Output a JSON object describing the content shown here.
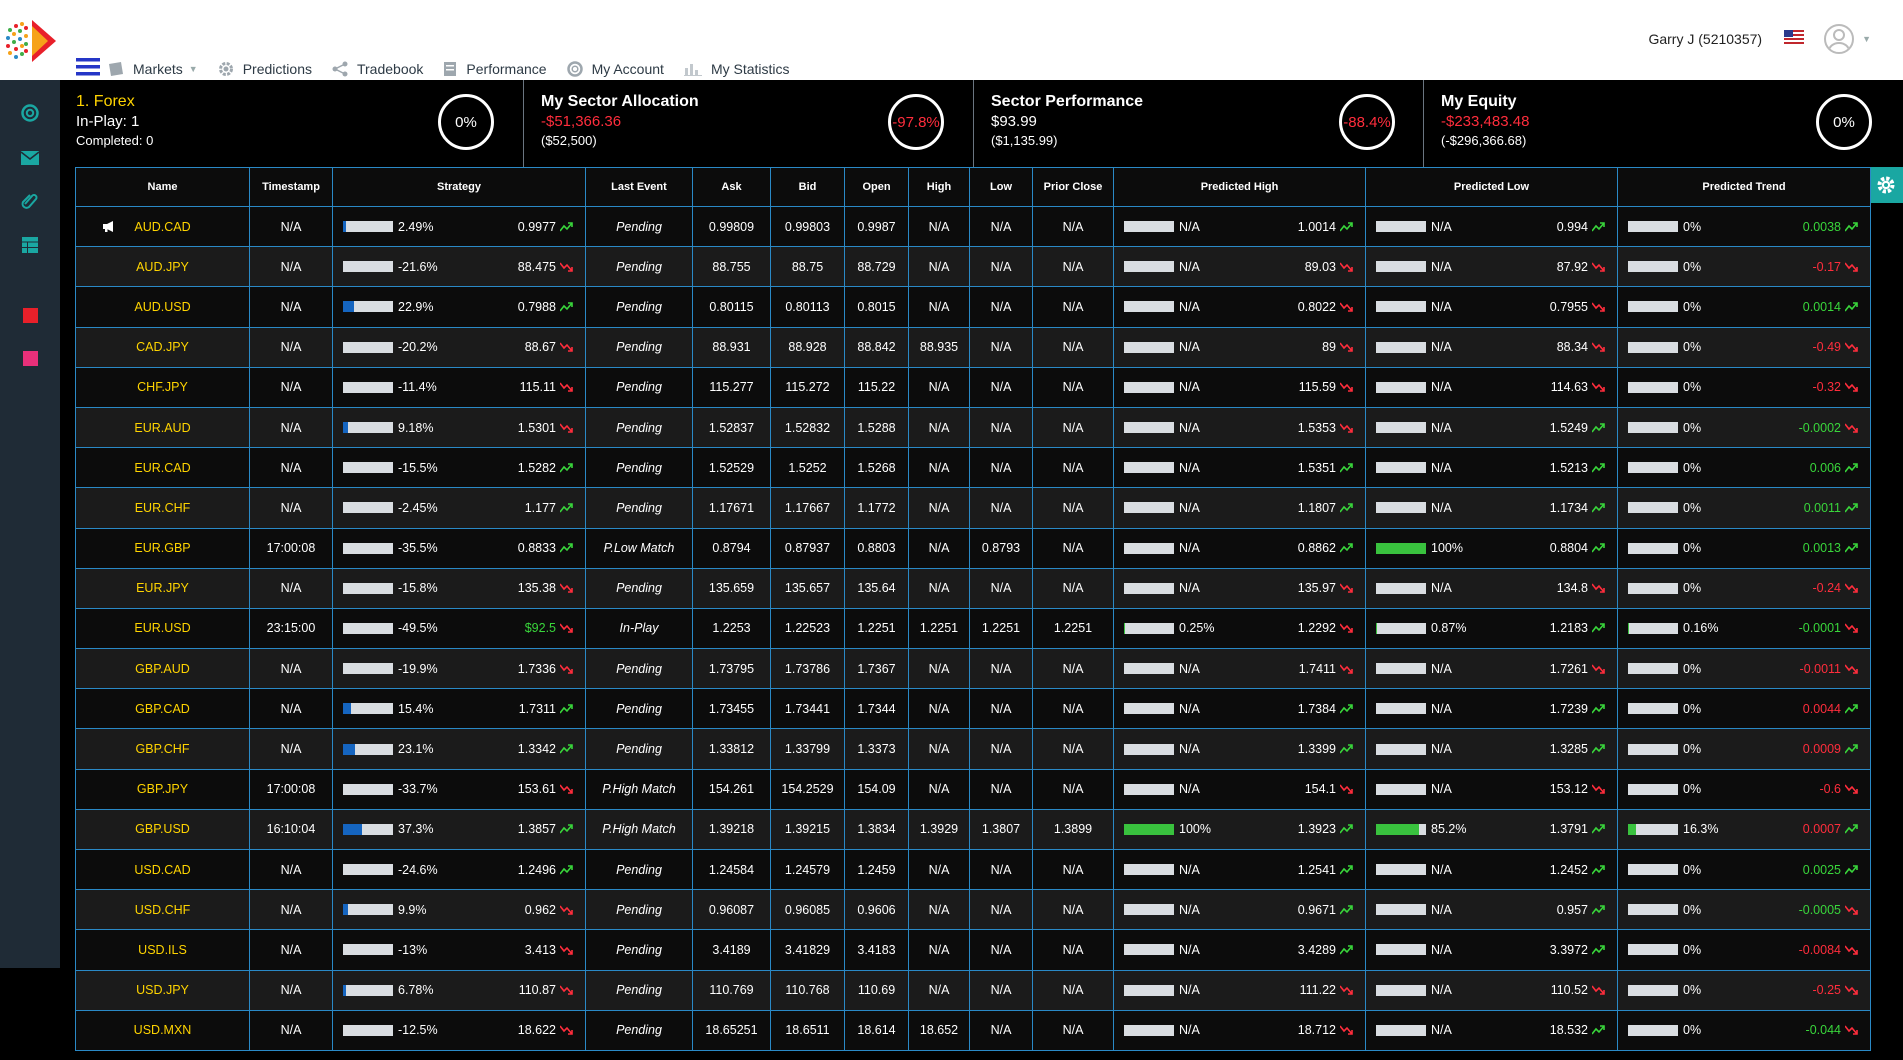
{
  "header": {
    "nav": [
      {
        "label": "Markets",
        "icon": "markets-icon",
        "has_caret": true
      },
      {
        "label": "Predictions",
        "icon": "gear-icon"
      },
      {
        "label": "Tradebook",
        "icon": "share-icon"
      },
      {
        "label": "Performance",
        "icon": "document-icon"
      },
      {
        "label": "My Account",
        "icon": "lifebuoy-icon"
      },
      {
        "label": "My Statistics",
        "icon": "bar-chart-icon"
      }
    ],
    "user": {
      "name": "Garry J (5210357)",
      "flag": "us-flag-icon"
    }
  },
  "sidebar": {
    "icons": [
      "lifebuoy-icon",
      "mail-icon",
      "paperclip-icon",
      "table-icon",
      "red-square-icon",
      "pink-square-icon"
    ]
  },
  "summary": {
    "forex": {
      "title": "1. Forex",
      "line2": "In-Play: 1",
      "line3": "Completed: 0",
      "ring": "0%"
    },
    "allocation": {
      "title": "My Sector Allocation",
      "line2": "-$51,366.36",
      "line3": "($52,500)",
      "ring": "-97.8%"
    },
    "performance": {
      "title": "Sector Performance",
      "line2": "$93.99",
      "line3": "($1,135.99)",
      "ring": "-88.4%"
    },
    "equity": {
      "title": "My Equity",
      "line2": "-$233,483.48",
      "line3": "(-$296,366.68)",
      "ring": "0%"
    }
  },
  "colors": {
    "up": "#39d63b",
    "down": "#ff2d3c",
    "accent": "#2a89c6",
    "name": "#ffd400",
    "strategy_fill": "#1565c0",
    "pred_fill": "#39c23e"
  },
  "table": {
    "headers": [
      "Name",
      "Timestamp",
      "Strategy",
      "Last Event",
      "Ask",
      "Bid",
      "Open",
      "High",
      "Low",
      "Prior Close",
      "Predicted High",
      "Predicted Low",
      "Predicted Trend"
    ],
    "rows": [
      {
        "name": "AUD.CAD",
        "ts": "N/A",
        "s_pct": "2.49%",
        "s_fill": 0.05,
        "s_val": "0.9977",
        "s_dir": "up",
        "s_col": "",
        "event": "Pending",
        "ask": "0.99809",
        "bid": "0.99803",
        "open": "0.9987",
        "high": "N/A",
        "low": "N/A",
        "prior": "N/A",
        "ph_pct": "N/A",
        "ph_fill": 0,
        "ph_val": "1.0014",
        "ph_dir": "up",
        "pl_pct": "N/A",
        "pl_fill": 0,
        "pl_val": "0.994",
        "pl_dir": "up",
        "pt_pct": "0%",
        "pt_fill": 0,
        "pt_val": "0.0038",
        "pt_dir": "up",
        "pt_col": "up",
        "megaphone": true
      },
      {
        "name": "AUD.JPY",
        "ts": "N/A",
        "s_pct": "-21.6%",
        "s_fill": 0,
        "s_val": "88.475",
        "s_dir": "down",
        "s_col": "",
        "event": "Pending",
        "ask": "88.755",
        "bid": "88.75",
        "open": "88.729",
        "high": "N/A",
        "low": "N/A",
        "prior": "N/A",
        "ph_pct": "N/A",
        "ph_fill": 0,
        "ph_val": "89.03",
        "ph_dir": "down",
        "pl_pct": "N/A",
        "pl_fill": 0,
        "pl_val": "87.92",
        "pl_dir": "down",
        "pt_pct": "0%",
        "pt_fill": 0,
        "pt_val": "-0.17",
        "pt_dir": "down",
        "pt_col": "down"
      },
      {
        "name": "AUD.USD",
        "ts": "N/A",
        "s_pct": "22.9%",
        "s_fill": 0.229,
        "s_val": "0.7988",
        "s_dir": "up",
        "s_col": "",
        "event": "Pending",
        "ask": "0.80115",
        "bid": "0.80113",
        "open": "0.8015",
        "high": "N/A",
        "low": "N/A",
        "prior": "N/A",
        "ph_pct": "N/A",
        "ph_fill": 0,
        "ph_val": "0.8022",
        "ph_dir": "down",
        "pl_pct": "N/A",
        "pl_fill": 0,
        "pl_val": "0.7955",
        "pl_dir": "down",
        "pt_pct": "0%",
        "pt_fill": 0,
        "pt_val": "0.0014",
        "pt_dir": "up",
        "pt_col": "up"
      },
      {
        "name": "CAD.JPY",
        "ts": "N/A",
        "s_pct": "-20.2%",
        "s_fill": 0,
        "s_val": "88.67",
        "s_dir": "down",
        "s_col": "",
        "event": "Pending",
        "ask": "88.931",
        "bid": "88.928",
        "open": "88.842",
        "high": "88.935",
        "low": "N/A",
        "prior": "N/A",
        "ph_pct": "N/A",
        "ph_fill": 0,
        "ph_val": "89",
        "ph_dir": "down",
        "pl_pct": "N/A",
        "pl_fill": 0,
        "pl_val": "88.34",
        "pl_dir": "down",
        "pt_pct": "0%",
        "pt_fill": 0,
        "pt_val": "-0.49",
        "pt_dir": "down",
        "pt_col": "down"
      },
      {
        "name": "CHF.JPY",
        "ts": "N/A",
        "s_pct": "-11.4%",
        "s_fill": 0,
        "s_val": "115.11",
        "s_dir": "down",
        "s_col": "",
        "event": "Pending",
        "ask": "115.277",
        "bid": "115.272",
        "open": "115.22",
        "high": "N/A",
        "low": "N/A",
        "prior": "N/A",
        "ph_pct": "N/A",
        "ph_fill": 0,
        "ph_val": "115.59",
        "ph_dir": "down",
        "pl_pct": "N/A",
        "pl_fill": 0,
        "pl_val": "114.63",
        "pl_dir": "down",
        "pt_pct": "0%",
        "pt_fill": 0,
        "pt_val": "-0.32",
        "pt_dir": "down",
        "pt_col": "down"
      },
      {
        "name": "EUR.AUD",
        "ts": "N/A",
        "s_pct": "9.18%",
        "s_fill": 0.092,
        "s_val": "1.5301",
        "s_dir": "down",
        "s_col": "",
        "event": "Pending",
        "ask": "1.52837",
        "bid": "1.52832",
        "open": "1.5288",
        "high": "N/A",
        "low": "N/A",
        "prior": "N/A",
        "ph_pct": "N/A",
        "ph_fill": 0,
        "ph_val": "1.5353",
        "ph_dir": "down",
        "pl_pct": "N/A",
        "pl_fill": 0,
        "pl_val": "1.5249",
        "pl_dir": "up",
        "pt_pct": "0%",
        "pt_fill": 0,
        "pt_val": "-0.0002",
        "pt_dir": "down",
        "pt_col": "up"
      },
      {
        "name": "EUR.CAD",
        "ts": "N/A",
        "s_pct": "-15.5%",
        "s_fill": 0,
        "s_val": "1.5282",
        "s_dir": "up",
        "s_col": "",
        "event": "Pending",
        "ask": "1.52529",
        "bid": "1.5252",
        "open": "1.5268",
        "high": "N/A",
        "low": "N/A",
        "prior": "N/A",
        "ph_pct": "N/A",
        "ph_fill": 0,
        "ph_val": "1.5351",
        "ph_dir": "up",
        "pl_pct": "N/A",
        "pl_fill": 0,
        "pl_val": "1.5213",
        "pl_dir": "up",
        "pt_pct": "0%",
        "pt_fill": 0,
        "pt_val": "0.006",
        "pt_dir": "up",
        "pt_col": "up"
      },
      {
        "name": "EUR.CHF",
        "ts": "N/A",
        "s_pct": "-2.45%",
        "s_fill": 0,
        "s_val": "1.177",
        "s_dir": "up",
        "s_col": "",
        "event": "Pending",
        "ask": "1.17671",
        "bid": "1.17667",
        "open": "1.1772",
        "high": "N/A",
        "low": "N/A",
        "prior": "N/A",
        "ph_pct": "N/A",
        "ph_fill": 0,
        "ph_val": "1.1807",
        "ph_dir": "up",
        "pl_pct": "N/A",
        "pl_fill": 0,
        "pl_val": "1.1734",
        "pl_dir": "up",
        "pt_pct": "0%",
        "pt_fill": 0,
        "pt_val": "0.0011",
        "pt_dir": "up",
        "pt_col": "up"
      },
      {
        "name": "EUR.GBP",
        "ts": "17:00:08",
        "s_pct": "-35.5%",
        "s_fill": 0,
        "s_val": "0.8833",
        "s_dir": "up",
        "s_col": "",
        "event": "P.Low Match",
        "ask": "0.8794",
        "bid": "0.87937",
        "open": "0.8803",
        "high": "N/A",
        "low": "0.8793",
        "prior": "N/A",
        "ph_pct": "N/A",
        "ph_fill": 0,
        "ph_val": "0.8862",
        "ph_dir": "up",
        "pl_pct": "100%",
        "pl_fill": 1,
        "pl_val": "0.8804",
        "pl_dir": "up",
        "pt_pct": "0%",
        "pt_fill": 0,
        "pt_val": "0.0013",
        "pt_dir": "up",
        "pt_col": "up"
      },
      {
        "name": "EUR.JPY",
        "ts": "N/A",
        "s_pct": "-15.8%",
        "s_fill": 0,
        "s_val": "135.38",
        "s_dir": "down",
        "s_col": "",
        "event": "Pending",
        "ask": "135.659",
        "bid": "135.657",
        "open": "135.64",
        "high": "N/A",
        "low": "N/A",
        "prior": "N/A",
        "ph_pct": "N/A",
        "ph_fill": 0,
        "ph_val": "135.97",
        "ph_dir": "down",
        "pl_pct": "N/A",
        "pl_fill": 0,
        "pl_val": "134.8",
        "pl_dir": "down",
        "pt_pct": "0%",
        "pt_fill": 0,
        "pt_val": "-0.24",
        "pt_dir": "down",
        "pt_col": "down"
      },
      {
        "name": "EUR.USD",
        "ts": "23:15:00",
        "s_pct": "-49.5%",
        "s_fill": 0,
        "s_val": "$92.5",
        "s_dir": "down",
        "s_col": "up",
        "event": "In-Play",
        "ask": "1.2253",
        "bid": "1.22523",
        "open": "1.2251",
        "high": "1.2251",
        "low": "1.2251",
        "prior": "1.2251",
        "ph_pct": "0.25%",
        "ph_fill": 0.0025,
        "ph_val": "1.2292",
        "ph_dir": "down",
        "pl_pct": "0.87%",
        "pl_fill": 0.0087,
        "pl_val": "1.2183",
        "pl_dir": "up",
        "pt_pct": "0.16%",
        "pt_fill": 0.0016,
        "pt_val": "-0.0001",
        "pt_dir": "down",
        "pt_col": "up"
      },
      {
        "name": "GBP.AUD",
        "ts": "N/A",
        "s_pct": "-19.9%",
        "s_fill": 0,
        "s_val": "1.7336",
        "s_dir": "down",
        "s_col": "",
        "event": "Pending",
        "ask": "1.73795",
        "bid": "1.73786",
        "open": "1.7367",
        "high": "N/A",
        "low": "N/A",
        "prior": "N/A",
        "ph_pct": "N/A",
        "ph_fill": 0,
        "ph_val": "1.7411",
        "ph_dir": "down",
        "pl_pct": "N/A",
        "pl_fill": 0,
        "pl_val": "1.7261",
        "pl_dir": "down",
        "pt_pct": "0%",
        "pt_fill": 0,
        "pt_val": "-0.0011",
        "pt_dir": "down",
        "pt_col": "down"
      },
      {
        "name": "GBP.CAD",
        "ts": "N/A",
        "s_pct": "15.4%",
        "s_fill": 0.154,
        "s_val": "1.7311",
        "s_dir": "up",
        "s_col": "",
        "event": "Pending",
        "ask": "1.73455",
        "bid": "1.73441",
        "open": "1.7344",
        "high": "N/A",
        "low": "N/A",
        "prior": "N/A",
        "ph_pct": "N/A",
        "ph_fill": 0,
        "ph_val": "1.7384",
        "ph_dir": "up",
        "pl_pct": "N/A",
        "pl_fill": 0,
        "pl_val": "1.7239",
        "pl_dir": "up",
        "pt_pct": "0%",
        "pt_fill": 0,
        "pt_val": "0.0044",
        "pt_dir": "up",
        "pt_col": "down"
      },
      {
        "name": "GBP.CHF",
        "ts": "N/A",
        "s_pct": "23.1%",
        "s_fill": 0.231,
        "s_val": "1.3342",
        "s_dir": "up",
        "s_col": "",
        "event": "Pending",
        "ask": "1.33812",
        "bid": "1.33799",
        "open": "1.3373",
        "high": "N/A",
        "low": "N/A",
        "prior": "N/A",
        "ph_pct": "N/A",
        "ph_fill": 0,
        "ph_val": "1.3399",
        "ph_dir": "up",
        "pl_pct": "N/A",
        "pl_fill": 0,
        "pl_val": "1.3285",
        "pl_dir": "up",
        "pt_pct": "0%",
        "pt_fill": 0,
        "pt_val": "0.0009",
        "pt_dir": "up",
        "pt_col": "down"
      },
      {
        "name": "GBP.JPY",
        "ts": "17:00:08",
        "s_pct": "-33.7%",
        "s_fill": 0,
        "s_val": "153.61",
        "s_dir": "down",
        "s_col": "",
        "event": "P.High Match",
        "ask": "154.261",
        "bid": "154.2529",
        "open": "154.09",
        "high": "N/A",
        "low": "N/A",
        "prior": "N/A",
        "ph_pct": "N/A",
        "ph_fill": 0,
        "ph_val": "154.1",
        "ph_dir": "down",
        "pl_pct": "N/A",
        "pl_fill": 0,
        "pl_val": "153.12",
        "pl_dir": "down",
        "pt_pct": "0%",
        "pt_fill": 0,
        "pt_val": "-0.6",
        "pt_dir": "down",
        "pt_col": "down"
      },
      {
        "name": "GBP.USD",
        "ts": "16:10:04",
        "s_pct": "37.3%",
        "s_fill": 0.373,
        "s_val": "1.3857",
        "s_dir": "up",
        "s_col": "",
        "event": "P.High Match",
        "ask": "1.39218",
        "bid": "1.39215",
        "open": "1.3834",
        "high": "1.3929",
        "low": "1.3807",
        "prior": "1.3899",
        "ph_pct": "100%",
        "ph_fill": 1,
        "ph_val": "1.3923",
        "ph_dir": "up",
        "pl_pct": "85.2%",
        "pl_fill": 0.852,
        "pl_val": "1.3791",
        "pl_dir": "up",
        "pt_pct": "16.3%",
        "pt_fill": 0.163,
        "pt_val": "0.0007",
        "pt_dir": "up",
        "pt_col": "down"
      },
      {
        "name": "USD.CAD",
        "ts": "N/A",
        "s_pct": "-24.6%",
        "s_fill": 0,
        "s_val": "1.2496",
        "s_dir": "up",
        "s_col": "",
        "event": "Pending",
        "ask": "1.24584",
        "bid": "1.24579",
        "open": "1.2459",
        "high": "N/A",
        "low": "N/A",
        "prior": "N/A",
        "ph_pct": "N/A",
        "ph_fill": 0,
        "ph_val": "1.2541",
        "ph_dir": "up",
        "pl_pct": "N/A",
        "pl_fill": 0,
        "pl_val": "1.2452",
        "pl_dir": "up",
        "pt_pct": "0%",
        "pt_fill": 0,
        "pt_val": "0.0025",
        "pt_dir": "up",
        "pt_col": "up"
      },
      {
        "name": "USD.CHF",
        "ts": "N/A",
        "s_pct": "9.9%",
        "s_fill": 0.099,
        "s_val": "0.962",
        "s_dir": "down",
        "s_col": "",
        "event": "Pending",
        "ask": "0.96087",
        "bid": "0.96085",
        "open": "0.9606",
        "high": "N/A",
        "low": "N/A",
        "prior": "N/A",
        "ph_pct": "N/A",
        "ph_fill": 0,
        "ph_val": "0.9671",
        "ph_dir": "up",
        "pl_pct": "N/A",
        "pl_fill": 0,
        "pl_val": "0.957",
        "pl_dir": "up",
        "pt_pct": "0%",
        "pt_fill": 0,
        "pt_val": "-0.0005",
        "pt_dir": "down",
        "pt_col": "up"
      },
      {
        "name": "USD.ILS",
        "ts": "N/A",
        "s_pct": "-13%",
        "s_fill": 0,
        "s_val": "3.413",
        "s_dir": "down",
        "s_col": "",
        "event": "Pending",
        "ask": "3.4189",
        "bid": "3.41829",
        "open": "3.4183",
        "high": "N/A",
        "low": "N/A",
        "prior": "N/A",
        "ph_pct": "N/A",
        "ph_fill": 0,
        "ph_val": "3.4289",
        "ph_dir": "up",
        "pl_pct": "N/A",
        "pl_fill": 0,
        "pl_val": "3.3972",
        "pl_dir": "up",
        "pt_pct": "0%",
        "pt_fill": 0,
        "pt_val": "-0.0084",
        "pt_dir": "down",
        "pt_col": "down"
      },
      {
        "name": "USD.JPY",
        "ts": "N/A",
        "s_pct": "6.78%",
        "s_fill": 0.068,
        "s_val": "110.87",
        "s_dir": "down",
        "s_col": "",
        "event": "Pending",
        "ask": "110.769",
        "bid": "110.768",
        "open": "110.69",
        "high": "N/A",
        "low": "N/A",
        "prior": "N/A",
        "ph_pct": "N/A",
        "ph_fill": 0,
        "ph_val": "111.22",
        "ph_dir": "down",
        "pl_pct": "N/A",
        "pl_fill": 0,
        "pl_val": "110.52",
        "pl_dir": "down",
        "pt_pct": "0%",
        "pt_fill": 0,
        "pt_val": "-0.25",
        "pt_dir": "down",
        "pt_col": "down"
      },
      {
        "name": "USD.MXN",
        "ts": "N/A",
        "s_pct": "-12.5%",
        "s_fill": 0,
        "s_val": "18.622",
        "s_dir": "down",
        "s_col": "",
        "event": "Pending",
        "ask": "18.65251",
        "bid": "18.6511",
        "open": "18.614",
        "high": "18.652",
        "low": "N/A",
        "prior": "N/A",
        "ph_pct": "N/A",
        "ph_fill": 0,
        "ph_val": "18.712",
        "ph_dir": "down",
        "pl_pct": "N/A",
        "pl_fill": 0,
        "pl_val": "18.532",
        "pl_dir": "up",
        "pt_pct": "0%",
        "pt_fill": 0,
        "pt_val": "-0.044",
        "pt_dir": "down",
        "pt_col": "up"
      }
    ]
  }
}
